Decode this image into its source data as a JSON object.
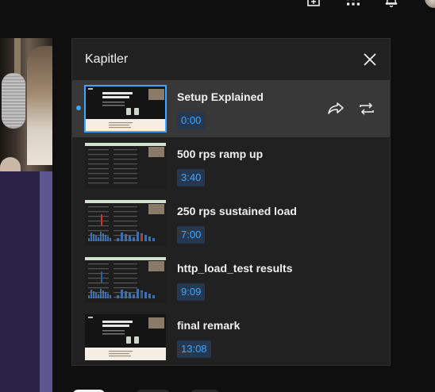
{
  "topbar": {
    "icons": [
      "create-icon",
      "apps-icon",
      "bell-icon"
    ]
  },
  "panel": {
    "title": "Kapitler",
    "close_icon": "close-icon"
  },
  "chapters": [
    {
      "title": "Setup Explained",
      "time": "0:00",
      "active": true,
      "thumb": "webpage"
    },
    {
      "title": "500 rps ramp up",
      "time": "3:40",
      "active": false,
      "thumb": "dashboard"
    },
    {
      "title": "250 rps sustained load",
      "time": "7:00",
      "active": false,
      "thumb": "dashboard-red"
    },
    {
      "title": "http_load_test results",
      "time": "9:09",
      "active": false,
      "thumb": "dashboard-blue"
    },
    {
      "title": "final remark",
      "time": "13:08",
      "active": false,
      "thumb": "webpage"
    }
  ],
  "actions": {
    "share_icon": "share-icon",
    "loop_icon": "loop-icon"
  },
  "colors": {
    "accent": "#3ea6ff",
    "panel_bg": "#212121",
    "active_row_bg": "#383838",
    "timestamp_bg": "#263850"
  }
}
